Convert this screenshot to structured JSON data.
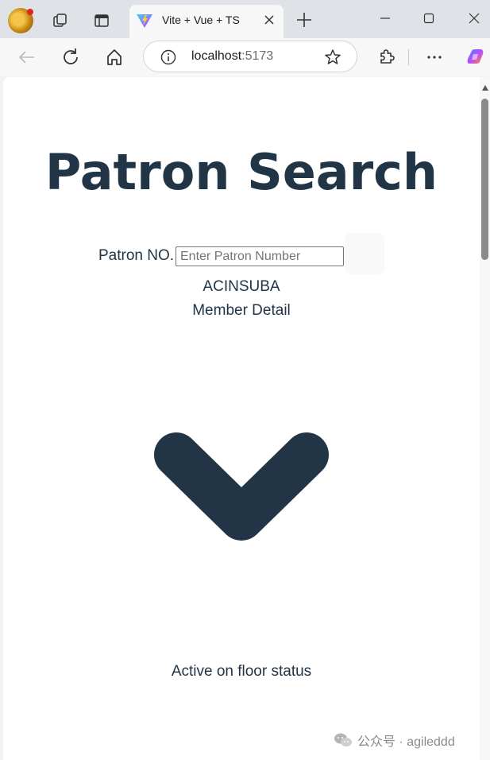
{
  "browser": {
    "tab_title": "Vite + Vue + TS",
    "address_host": "localhost",
    "address_port": ":5173"
  },
  "page": {
    "title": "Patron Search",
    "patron_label": "Patron NO.",
    "patron_input_placeholder": "Enter Patron Number",
    "patron_input_value": "",
    "member_code": "ACINSUBA",
    "member_detail": "Member Detail",
    "status_text": "Active on floor status"
  },
  "watermark": {
    "text": "公众号 · agileddd"
  },
  "colors": {
    "accent": "#213547",
    "tab_strip": "#dfe3e8",
    "toolbar": "#f7f7f7"
  },
  "icons": [
    "profile-avatar",
    "workspaces-icon",
    "tab-actions-icon",
    "vite-icon",
    "close-icon",
    "plus-icon",
    "minimize-icon",
    "maximize-icon",
    "window-close-icon",
    "back-icon",
    "refresh-icon",
    "home-icon",
    "info-icon",
    "favorite-star-icon",
    "extensions-icon",
    "more-icon",
    "copilot-icon",
    "chevron-down-icon",
    "wechat-icon"
  ]
}
